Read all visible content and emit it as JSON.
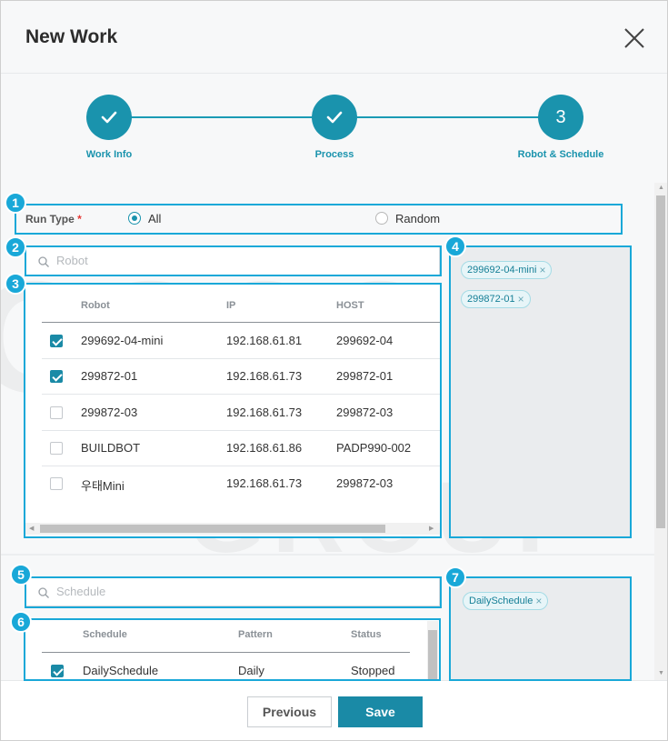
{
  "dialog": {
    "title": "New Work"
  },
  "steps": [
    {
      "label": "Work Info",
      "state": "done"
    },
    {
      "label": "Process",
      "state": "done"
    },
    {
      "label": "Robot & Schedule",
      "number": "3",
      "state": "active"
    }
  ],
  "run_type": {
    "label": "Run Type",
    "required_mark": "*",
    "options": [
      "All",
      "Random"
    ],
    "selected": "All"
  },
  "robot_search": {
    "placeholder": "Robot"
  },
  "robot_table": {
    "columns": [
      "Robot",
      "IP",
      "HOST"
    ],
    "rows": [
      {
        "checked": true,
        "robot": "299692-04-mini",
        "ip": "192.168.61.81",
        "host": "299692-04"
      },
      {
        "checked": true,
        "robot": "299872-01",
        "ip": "192.168.61.73",
        "host": "299872-01"
      },
      {
        "checked": false,
        "robot": "299872-03",
        "ip": "192.168.61.73",
        "host": "299872-03"
      },
      {
        "checked": false,
        "robot": "BUILDBOT",
        "ip": "192.168.61.86",
        "host": "PADP990-002"
      },
      {
        "checked": false,
        "robot": "우태Mini",
        "ip": "192.168.61.73",
        "host": "299872-03"
      }
    ]
  },
  "selected_robots": [
    "299692-04-mini",
    "299872-01"
  ],
  "schedule_search": {
    "placeholder": "Schedule"
  },
  "schedule_table": {
    "columns": [
      "Schedule",
      "Pattern",
      "Status"
    ],
    "rows": [
      {
        "checked": true,
        "schedule": "DailySchedule",
        "pattern": "Daily",
        "status": "Stopped"
      }
    ]
  },
  "selected_schedules": [
    "DailySchedule"
  ],
  "callouts": [
    "1",
    "2",
    "3",
    "4",
    "5",
    "6",
    "7"
  ],
  "footer": {
    "previous_label": "Previous",
    "save_label": "Save"
  },
  "colors": {
    "accent": "#1a93ad",
    "callout": "#19a8d8",
    "required": "#e53935"
  },
  "icons": {
    "close": "close-icon",
    "check": "check-icon",
    "search": "search-icon",
    "remove": "remove-x-icon"
  }
}
